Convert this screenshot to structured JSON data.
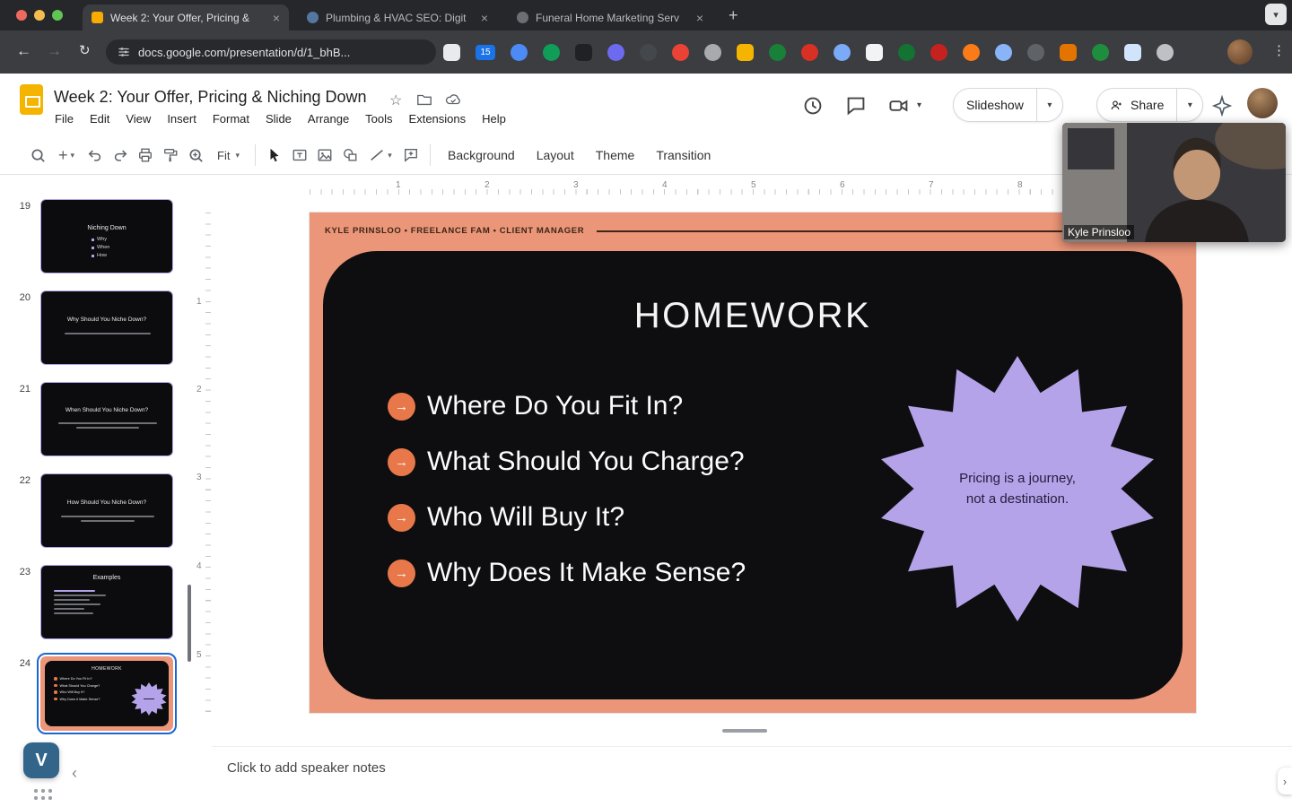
{
  "browser": {
    "tabs": [
      {
        "title": "Week 2: Your Offer, Pricing &"
      },
      {
        "title": "Plumbing & HVAC SEO: Digit"
      },
      {
        "title": "Funeral Home Marketing Serv"
      }
    ],
    "url": "docs.google.com/presentation/d/1_bhB...",
    "extension_badge": "15"
  },
  "icons": {
    "close": "×",
    "plus": "+",
    "chevron_down": "▾",
    "back": "←",
    "forward": "→",
    "reload": "↻",
    "overflow": "⋮",
    "star_outline": "☆",
    "arrow_right": "→",
    "chevron_left": "‹",
    "chevron_right": "›",
    "vimeo": "V"
  },
  "header": {
    "doc_title": "Week 2: Your Offer, Pricing & Niching Down",
    "menus": [
      "File",
      "Edit",
      "View",
      "Insert",
      "Format",
      "Slide",
      "Arrange",
      "Tools",
      "Extensions",
      "Help"
    ],
    "slideshow": "Slideshow",
    "share": "Share"
  },
  "toolbar": {
    "fit": "Fit",
    "background": "Background",
    "layout": "Layout",
    "theme": "Theme",
    "transition": "Transition"
  },
  "rulers": {
    "h": [
      "1",
      "2",
      "3",
      "4",
      "5",
      "6",
      "7",
      "8"
    ],
    "v": [
      "1",
      "2",
      "3",
      "4",
      "5"
    ]
  },
  "filmstrip": [
    {
      "num": "19",
      "title": "Niching Down",
      "bullets": [
        "Why",
        "When",
        "How"
      ]
    },
    {
      "num": "20",
      "title": "Why Should You Niche Down?"
    },
    {
      "num": "21",
      "title": "When Should You Niche Down?"
    },
    {
      "num": "22",
      "title": "How Should You Niche Down?"
    },
    {
      "num": "23",
      "title": "Examples"
    },
    {
      "num": "24",
      "title": "HOMEWORK"
    }
  ],
  "slide": {
    "eyebrow": "KYLE PRINSLOO  •  FREELANCE FAM  •  CLIENT MANAGER",
    "title": "HOMEWORK",
    "bullets": [
      "Where Do You Fit In?",
      "What Should You Charge?",
      "Who Will Buy It?",
      "Why Does It Make Sense?"
    ],
    "star_line1": "Pricing is a journey,",
    "star_line2": "not a destination."
  },
  "notes": {
    "placeholder": "Click to add speaker notes"
  },
  "webcam": {
    "name": "Kyle Prinsloo"
  },
  "colors": {
    "slide_background": "#EB9679",
    "slide_box": "#0E0E10",
    "accent_purple": "#B4A3E9",
    "accent_orange": "#E8784A",
    "selection_blue": "#1967D2"
  }
}
